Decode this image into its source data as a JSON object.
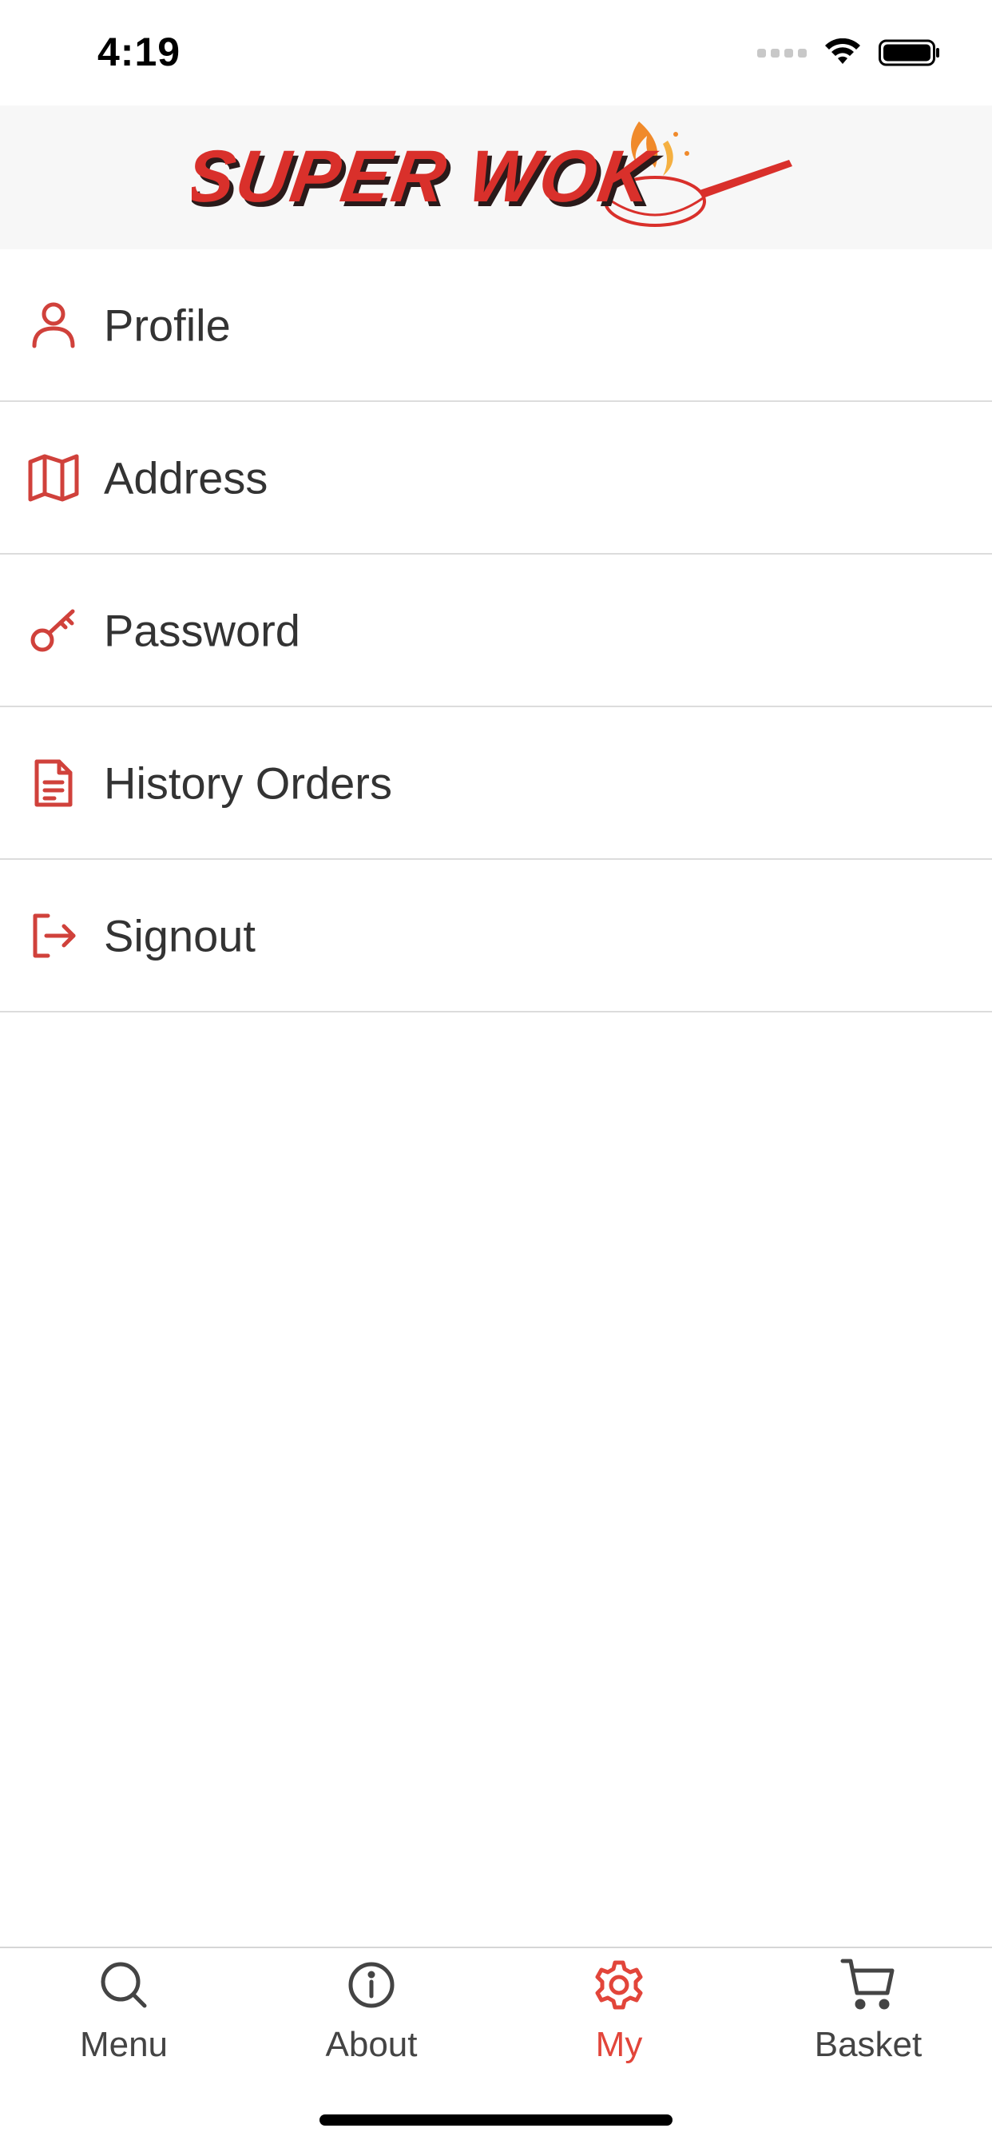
{
  "status_bar": {
    "time": "4:19"
  },
  "header": {
    "logo_text": "SUPER WOK"
  },
  "menu": {
    "items": [
      {
        "label": "Profile",
        "icon": "user-icon"
      },
      {
        "label": "Address",
        "icon": "map-icon"
      },
      {
        "label": "Password",
        "icon": "key-icon"
      },
      {
        "label": "History Orders",
        "icon": "document-icon"
      },
      {
        "label": "Signout",
        "icon": "signout-icon"
      }
    ]
  },
  "tab_bar": {
    "tabs": [
      {
        "label": "Menu",
        "icon": "search-icon",
        "active": false
      },
      {
        "label": "About",
        "icon": "info-icon",
        "active": false
      },
      {
        "label": "My",
        "icon": "gear-icon",
        "active": true
      },
      {
        "label": "Basket",
        "icon": "cart-icon",
        "active": false
      }
    ]
  },
  "colors": {
    "accent": "#e2453a",
    "icon_red": "#d0413b",
    "logo_red": "#d9302b",
    "text": "#333333"
  }
}
